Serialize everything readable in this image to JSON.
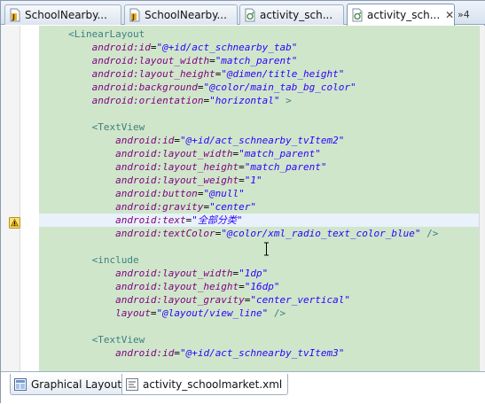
{
  "editor_tabs": [
    {
      "label": "SchoolNearby...",
      "icon": "java-file-icon",
      "active": false
    },
    {
      "label": "SchoolNearby...",
      "icon": "java-file-icon",
      "active": false
    },
    {
      "label": "activity_sch...",
      "icon": "xml-file-icon",
      "active": false
    },
    {
      "label": "activity_sch...",
      "icon": "xml-file-icon",
      "active": true
    }
  ],
  "tab_close_label": "✕",
  "overflow_label": "»4",
  "code_lines": [
    {
      "indent": "    ",
      "parts": [
        {
          "t": "tag",
          "s": "<LinearLayout"
        }
      ]
    },
    {
      "indent": "        ",
      "parts": [
        {
          "t": "attr",
          "s": "android:id"
        },
        {
          "t": "eq",
          "s": "="
        },
        {
          "t": "val",
          "s": "\"@+id/act_schnearby_tab\""
        }
      ]
    },
    {
      "indent": "        ",
      "parts": [
        {
          "t": "attr",
          "s": "android:layout_width"
        },
        {
          "t": "eq",
          "s": "="
        },
        {
          "t": "val",
          "s": "\"match_parent\""
        }
      ]
    },
    {
      "indent": "        ",
      "parts": [
        {
          "t": "attr",
          "s": "android:layout_height"
        },
        {
          "t": "eq",
          "s": "="
        },
        {
          "t": "val",
          "s": "\"@dimen/title_height\""
        }
      ]
    },
    {
      "indent": "        ",
      "parts": [
        {
          "t": "attr",
          "s": "android:background"
        },
        {
          "t": "eq",
          "s": "="
        },
        {
          "t": "val",
          "s": "\"@color/main_tab_bg_color\""
        }
      ]
    },
    {
      "indent": "        ",
      "parts": [
        {
          "t": "attr",
          "s": "android:orientation"
        },
        {
          "t": "eq",
          "s": "="
        },
        {
          "t": "val",
          "s": "\"horizontal\""
        },
        {
          "t": "tag",
          "s": " >"
        }
      ]
    },
    {
      "indent": "",
      "parts": []
    },
    {
      "indent": "        ",
      "parts": [
        {
          "t": "tag",
          "s": "<TextView"
        }
      ]
    },
    {
      "indent": "            ",
      "parts": [
        {
          "t": "attr",
          "s": "android:id"
        },
        {
          "t": "eq",
          "s": "="
        },
        {
          "t": "val",
          "s": "\"@+id/act_schnearby_tvItem2\""
        }
      ]
    },
    {
      "indent": "            ",
      "parts": [
        {
          "t": "attr",
          "s": "android:layout_width"
        },
        {
          "t": "eq",
          "s": "="
        },
        {
          "t": "val",
          "s": "\"match_parent\""
        }
      ]
    },
    {
      "indent": "            ",
      "parts": [
        {
          "t": "attr",
          "s": "android:layout_height"
        },
        {
          "t": "eq",
          "s": "="
        },
        {
          "t": "val",
          "s": "\"match_parent\""
        }
      ]
    },
    {
      "indent": "            ",
      "parts": [
        {
          "t": "attr",
          "s": "android:layout_weight"
        },
        {
          "t": "eq",
          "s": "="
        },
        {
          "t": "val",
          "s": "\"1\""
        }
      ]
    },
    {
      "indent": "            ",
      "parts": [
        {
          "t": "attr",
          "s": "android:button"
        },
        {
          "t": "eq",
          "s": "="
        },
        {
          "t": "val",
          "s": "\"@null\""
        }
      ]
    },
    {
      "indent": "            ",
      "parts": [
        {
          "t": "attr",
          "s": "android:gravity"
        },
        {
          "t": "eq",
          "s": "="
        },
        {
          "t": "val",
          "s": "\"center\""
        }
      ]
    },
    {
      "indent": "            ",
      "current": true,
      "parts": [
        {
          "t": "attr",
          "s": "android:text"
        },
        {
          "t": "eq",
          "s": "="
        },
        {
          "t": "val",
          "s": "\"全部分类\""
        }
      ]
    },
    {
      "indent": "            ",
      "parts": [
        {
          "t": "attr",
          "s": "android:textColor"
        },
        {
          "t": "eq",
          "s": "="
        },
        {
          "t": "val",
          "s": "\"@color/xml_radio_text_color_blue\""
        },
        {
          "t": "tag",
          "s": " />"
        }
      ]
    },
    {
      "indent": "",
      "parts": []
    },
    {
      "indent": "        ",
      "parts": [
        {
          "t": "tag",
          "s": "<include"
        }
      ]
    },
    {
      "indent": "            ",
      "parts": [
        {
          "t": "attr",
          "s": "android:layout_width"
        },
        {
          "t": "eq",
          "s": "="
        },
        {
          "t": "val",
          "s": "\"1dp\""
        }
      ]
    },
    {
      "indent": "            ",
      "parts": [
        {
          "t": "attr",
          "s": "android:layout_height"
        },
        {
          "t": "eq",
          "s": "="
        },
        {
          "t": "val",
          "s": "\"16dp\""
        }
      ]
    },
    {
      "indent": "            ",
      "parts": [
        {
          "t": "attr",
          "s": "android:layout_gravity"
        },
        {
          "t": "eq",
          "s": "="
        },
        {
          "t": "val",
          "s": "\"center_vertical\""
        }
      ]
    },
    {
      "indent": "            ",
      "parts": [
        {
          "t": "attr",
          "s": "layout"
        },
        {
          "t": "eq",
          "s": "="
        },
        {
          "t": "val",
          "s": "\"@layout/view_line\""
        },
        {
          "t": "tag",
          "s": " />"
        }
      ]
    },
    {
      "indent": "",
      "parts": []
    },
    {
      "indent": "        ",
      "parts": [
        {
          "t": "tag",
          "s": "<TextView"
        }
      ]
    },
    {
      "indent": "            ",
      "parts": [
        {
          "t": "attr",
          "s": "android:id"
        },
        {
          "t": "eq",
          "s": "="
        },
        {
          "t": "val",
          "s": "\"@+id/act_schnearby_tvItem3\""
        }
      ]
    }
  ],
  "bottom_tabs": [
    {
      "label": "Graphical Layout",
      "icon": "layout-icon",
      "active": false
    },
    {
      "label": "activity_schoolmarket.xml",
      "icon": "xml-source-icon",
      "active": true
    }
  ],
  "colors": {
    "code_background": "#cfe6cb",
    "tag": "#3f7f7f",
    "attribute": "#7f007f",
    "value": "#2a00ff",
    "current_line": "#e9f1fb"
  }
}
